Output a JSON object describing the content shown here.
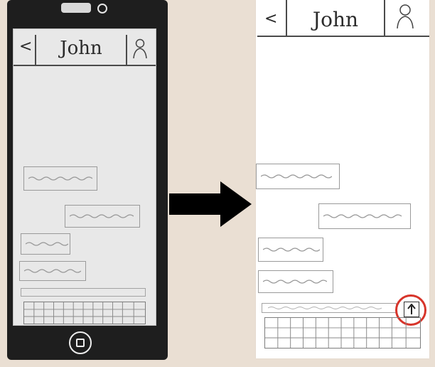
{
  "left_prototype": {
    "header": {
      "back_label": "<",
      "title": "John",
      "profile_icon": "person-icon"
    },
    "messages": [
      "incoming",
      "outgoing",
      "incoming",
      "incoming"
    ]
  },
  "right_prototype": {
    "header": {
      "back_label": "<",
      "title": "John",
      "profile_icon": "person-icon"
    },
    "messages": [
      "incoming",
      "outgoing",
      "incoming",
      "incoming"
    ],
    "send_icon": "up-arrow-icon",
    "highlight_color": "#d7342a"
  },
  "transition_icon": "right-arrow-icon"
}
